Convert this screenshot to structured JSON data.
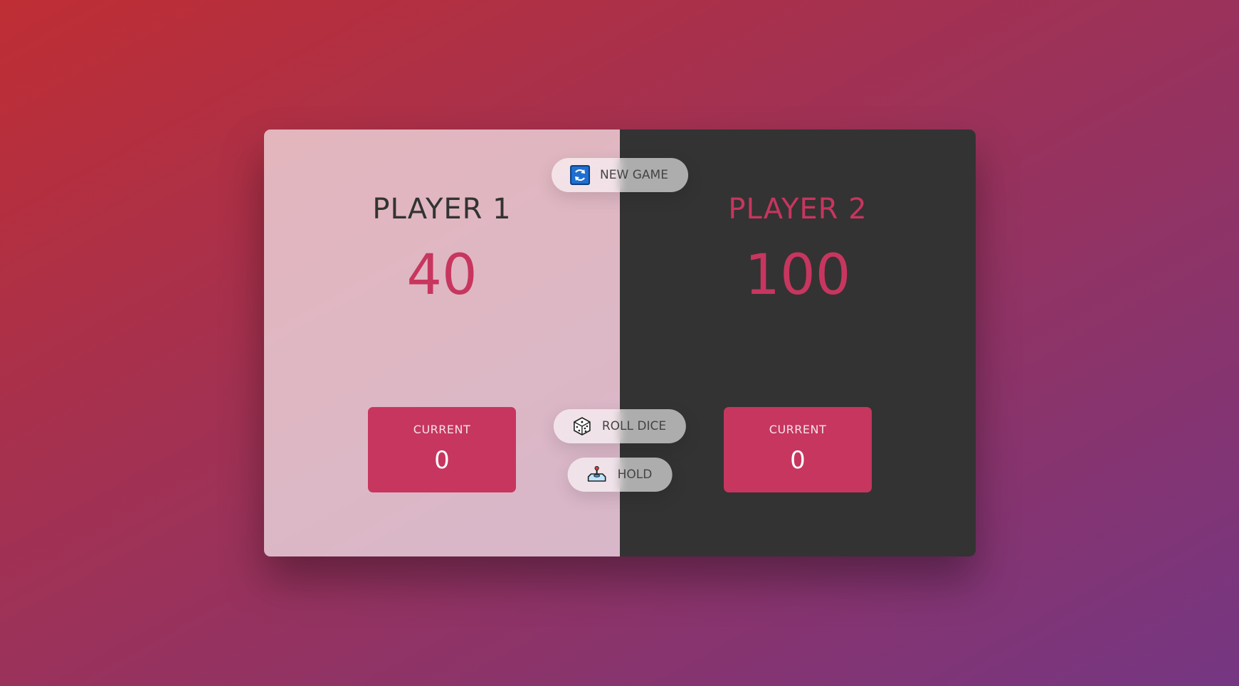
{
  "players": [
    {
      "name": "PLAYER 1",
      "score": "40",
      "current_label": "CURRENT",
      "current_score": "0",
      "active": true
    },
    {
      "name": "PLAYER 2",
      "score": "100",
      "current_label": "CURRENT",
      "current_score": "0",
      "active": false
    }
  ],
  "buttons": {
    "new_game": {
      "label": "NEW GAME",
      "icon": "refresh-icon"
    },
    "roll_dice": {
      "label": "ROLL DICE",
      "icon": "dice-icon"
    },
    "hold": {
      "label": "HOLD",
      "icon": "joystick-icon"
    }
  },
  "colors": {
    "accent": "#c7365f",
    "dark_panel": "#333333",
    "gradient_start": "#bf2e34",
    "gradient_end": "#753682"
  }
}
